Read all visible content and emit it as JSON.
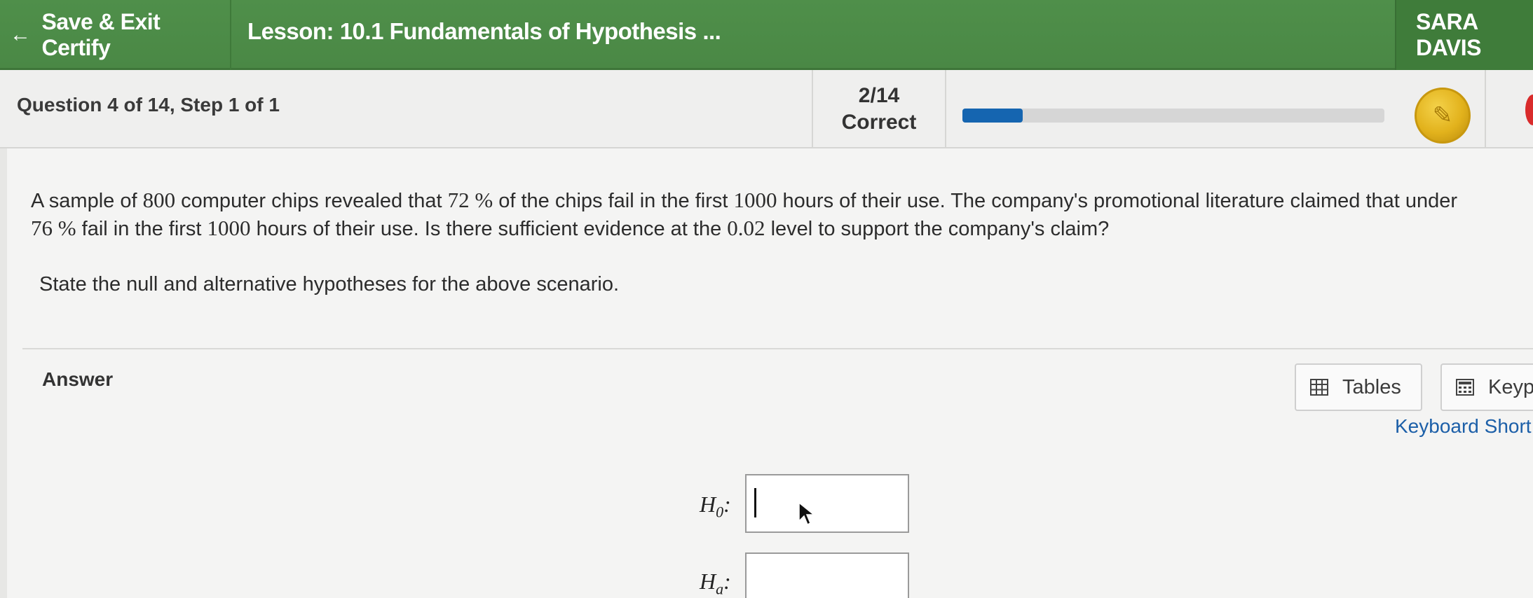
{
  "header": {
    "exit_label": "Save & Exit Certify",
    "lesson_title": "Lesson: 10.1 Fundamentals of Hypothesis ...",
    "user_name": "SARA DAVIS"
  },
  "status": {
    "question_label": "Question 4 of 14, Step 1 of 1",
    "score": "2/14",
    "score_label": "Correct",
    "progress_fraction": 0.1429
  },
  "problem": {
    "line1_parts": [
      "A sample of ",
      "800",
      " computer chips revealed that ",
      "72 %",
      "  of the chips fail in the first ",
      "1000",
      " hours of their use.  The company's promotional literature claimed that under"
    ],
    "line2_parts": [
      "76 %",
      "  fail in the first ",
      "1000",
      " hours of their use.  Is there sufficient evidence at the ",
      "0.02",
      " level to support the company's claim?"
    ],
    "instruction": "State the null and alternative hypotheses for the above scenario."
  },
  "answer": {
    "label": "Answer",
    "tables_label": "Tables",
    "keypad_label": "Keyp",
    "shortcuts_label": "Keyboard Short",
    "h0_symbol": "H",
    "h0_sub": "0",
    "ha_symbol": "H",
    "ha_sub": "a",
    "colon": ":",
    "h0_value": "",
    "ha_value": ""
  },
  "icons": {
    "back": "left-arrow-icon",
    "tables": "table-grid-icon",
    "keypad": "calculator-icon",
    "badge": "gold-coin-icon"
  },
  "colors": {
    "header_green": "#4f8f4a",
    "progress_blue": "#1565b0",
    "link_blue": "#1c5fa8",
    "coin_gold": "#e2b21c"
  }
}
